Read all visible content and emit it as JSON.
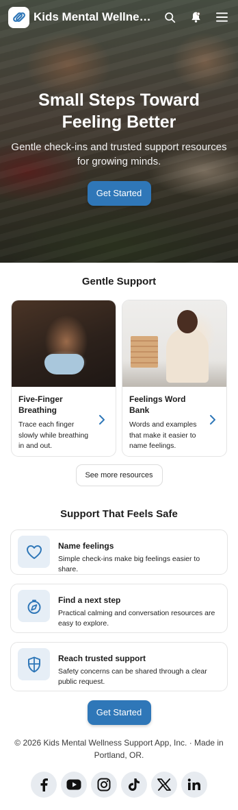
{
  "header": {
    "app_title": "Kids Mental Wellness S..."
  },
  "hero": {
    "title": "Small Steps Toward Feeling Better",
    "subtitle": "Gentle check-ins and trusted support resources for growing minds.",
    "cta_label": "Get Started"
  },
  "gentle_support": {
    "title": "Gentle Support",
    "cards": [
      {
        "title": "Five-Finger Breathing",
        "description": "Trace each finger slowly while breathing in and out."
      },
      {
        "title": "Feelings Word Bank",
        "description": "Words and examples that make it easier to name feelings."
      }
    ],
    "see_more_label": "See more resources"
  },
  "safe": {
    "title": "Support That Feels Safe",
    "features": [
      {
        "title": "Name feelings",
        "description": "Simple check-ins make big feelings easier to share.",
        "icon": "heart-icon"
      },
      {
        "title": "Find a next step",
        "description": "Practical calming and conversation resources are easy to explore.",
        "icon": "compass-icon"
      },
      {
        "title": "Reach trusted support",
        "description": "Safety concerns can be shared through a clear public request.",
        "icon": "shield-icon"
      }
    ],
    "cta_label": "Get Started"
  },
  "footer": {
    "text": "© 2026 Kids Mental Wellness Support App, Inc. · Made in Portland, OR.",
    "socials": [
      "facebook-icon",
      "youtube-icon",
      "instagram-icon",
      "tiktok-icon",
      "x-icon",
      "linkedin-icon"
    ]
  },
  "colors": {
    "accent": "#2f77b8",
    "icon_bg": "#e6eef6",
    "social_bg": "#e7ebf0"
  }
}
